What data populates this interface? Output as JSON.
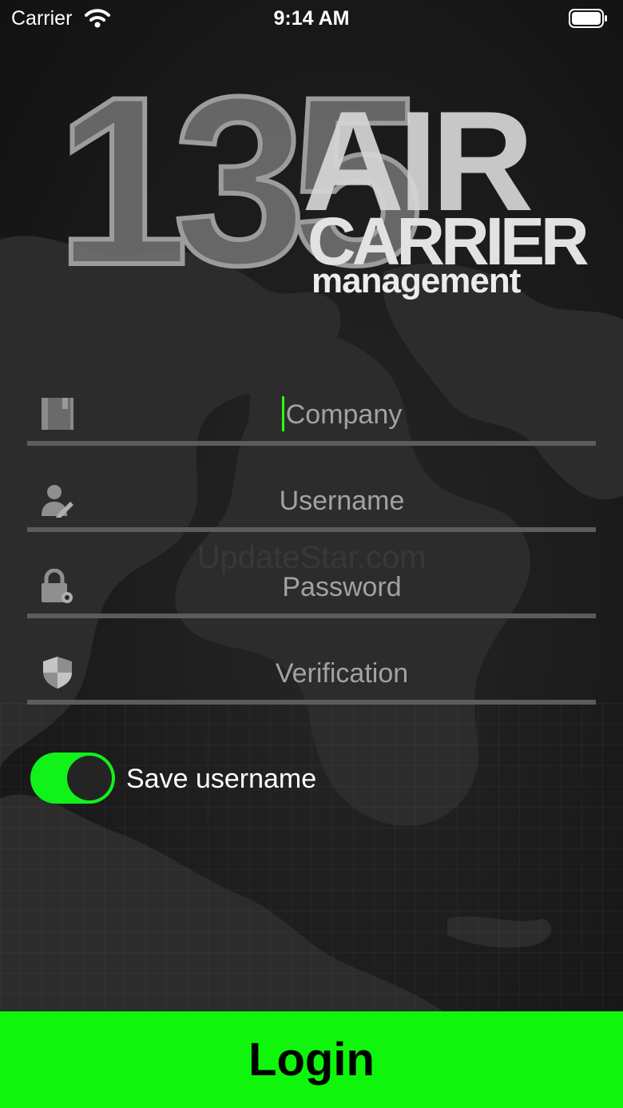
{
  "status_bar": {
    "carrier": "Carrier",
    "time": "9:14 AM"
  },
  "logo": {
    "number": "135",
    "line1": "AIR",
    "line2": "CARRIER",
    "line3": "management"
  },
  "form": {
    "fields": [
      {
        "placeholder": "Company",
        "icon": "book-icon"
      },
      {
        "placeholder": "Username",
        "icon": "user-edit-icon"
      },
      {
        "placeholder": "Password",
        "icon": "lock-gear-icon"
      },
      {
        "placeholder": "Verification",
        "icon": "shield-icon"
      }
    ],
    "save_username": {
      "label": "Save username",
      "on": true
    }
  },
  "watermark": "UpdateStar.com",
  "login_label": "Login",
  "colors": {
    "accent": "#0FF50C",
    "background": "#1B1B1B",
    "placeholder": "#A2A2A2",
    "underline": "#5C5C5C"
  }
}
